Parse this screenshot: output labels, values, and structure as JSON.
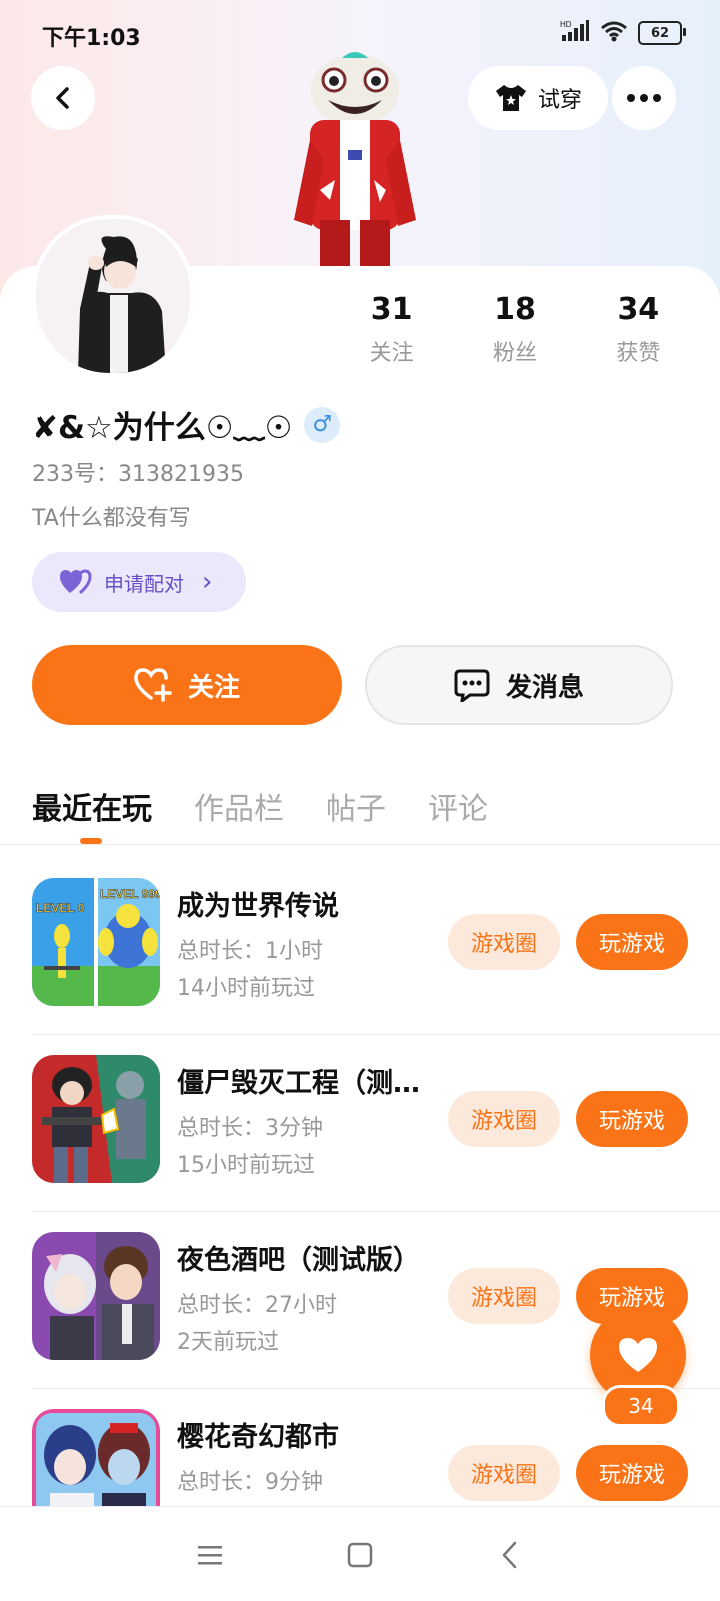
{
  "status_bar": {
    "time": "下午1:03",
    "network": "HD",
    "battery": "62"
  },
  "header": {
    "back_icon": "chevron-left-icon",
    "tryon_label": "试穿",
    "more_icon": "more-dots-icon"
  },
  "profile": {
    "stats": [
      {
        "value": "31",
        "label": "关注"
      },
      {
        "value": "18",
        "label": "粉丝"
      },
      {
        "value": "34",
        "label": "获赞"
      }
    ],
    "nickname": "✘&☆为什么☉﹏☉",
    "gender_symbol": "♂",
    "uid": "233号：313821935",
    "bio": "TA什么都没有写",
    "pair_label": "申请配对",
    "pair_chevron": "›"
  },
  "actions": {
    "follow_label": "关注",
    "message_label": "发消息"
  },
  "tabs": [
    {
      "label": "最近在玩"
    },
    {
      "label": "作品栏"
    },
    {
      "label": "帖子"
    },
    {
      "label": "评论"
    }
  ],
  "games": [
    {
      "title": "成为世界传说",
      "duration": "总时长：1小时",
      "last_played": "14小时前玩过",
      "circle_label": "游戏圈",
      "play_label": "玩游戏",
      "icon_left": "LEVEL 0",
      "icon_right": "LEVEL 999"
    },
    {
      "title": "僵尸毁灭工程（测…",
      "duration": "总时长：3分钟",
      "last_played": "15小时前玩过",
      "circle_label": "游戏圈",
      "play_label": "玩游戏"
    },
    {
      "title": "夜色酒吧（测试版）",
      "duration": "总时长：27小时",
      "last_played": "2天前玩过",
      "circle_label": "游戏圈",
      "play_label": "玩游戏"
    },
    {
      "title": "樱花奇幻都市",
      "duration": "总时长：9分钟",
      "last_played": "",
      "circle_label": "游戏圈",
      "play_label": "玩游戏"
    }
  ],
  "like_fab": {
    "count": "34"
  },
  "colors": {
    "accent": "#fa7417",
    "accent_light": "#fde9dc",
    "pair_bg": "#ece8fb",
    "pair_text": "#6650c6"
  }
}
